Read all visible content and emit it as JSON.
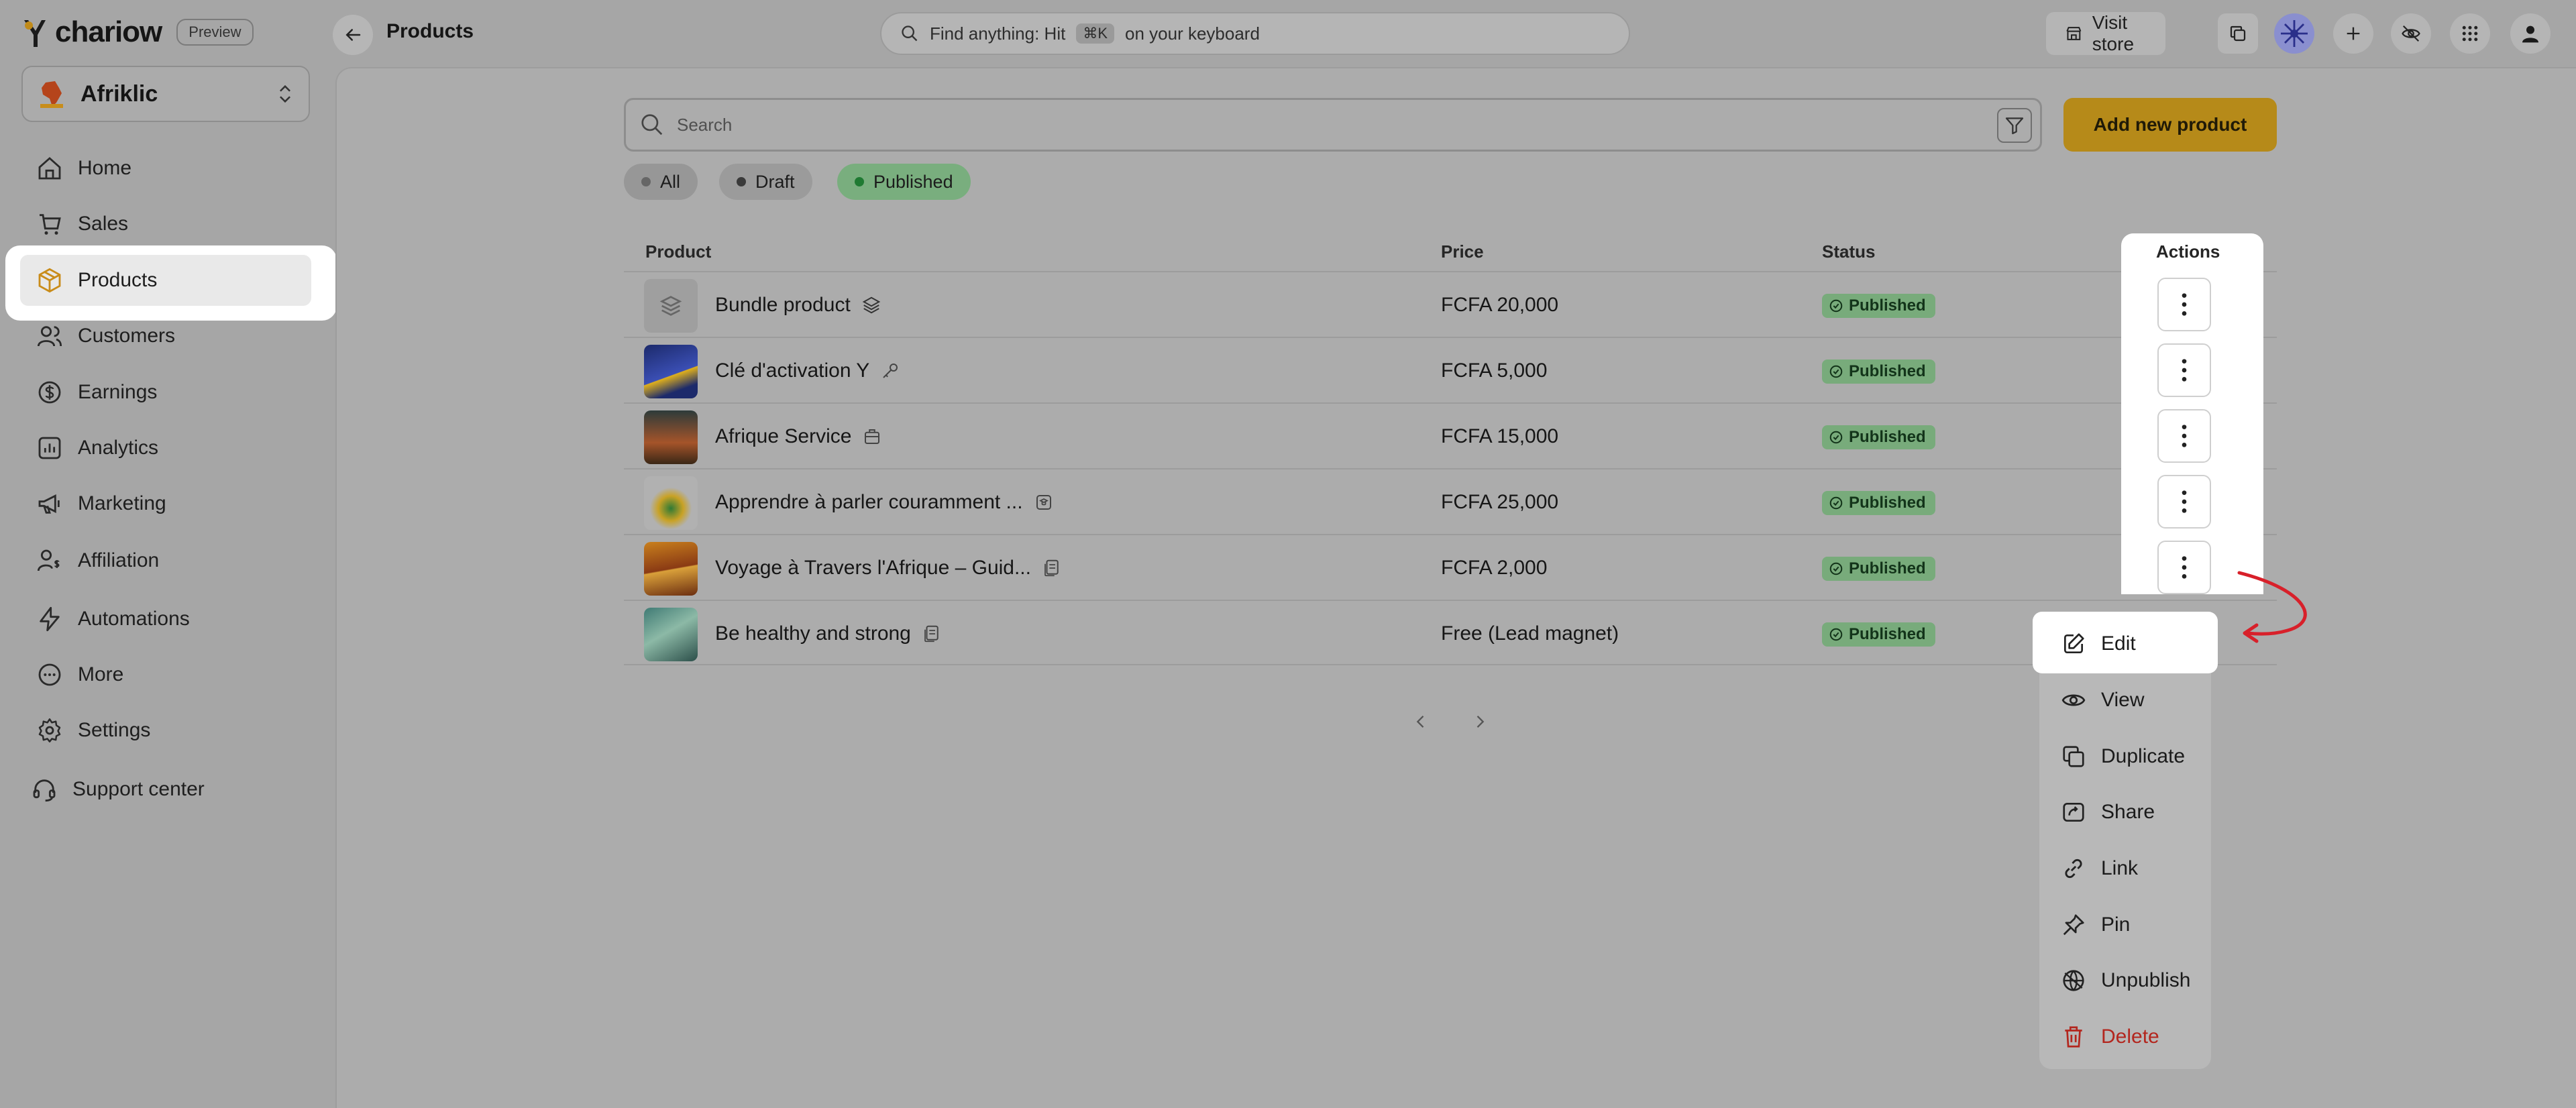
{
  "app": {
    "brand": "chariow",
    "preview_badge": "Preview",
    "page_title": "Products",
    "global_search_prefix": "Find anything: Hit",
    "global_search_kbd": "⌘K",
    "global_search_suffix": "on your keyboard",
    "visit_store": "Visit store"
  },
  "store": {
    "name": "Afriklic"
  },
  "sidebar": {
    "items": [
      {
        "label": "Home",
        "icon": "home-icon"
      },
      {
        "label": "Sales",
        "icon": "cart-icon"
      },
      {
        "label": "Products",
        "icon": "box-icon",
        "active": true
      },
      {
        "label": "Customers",
        "icon": "users-icon"
      },
      {
        "label": "Earnings",
        "icon": "earnings-icon"
      },
      {
        "label": "Analytics",
        "icon": "chart-icon"
      },
      {
        "label": "Marketing",
        "icon": "megaphone-icon"
      },
      {
        "label": "Affiliation",
        "icon": "affiliate-icon"
      },
      {
        "label": "Automations",
        "icon": "bolt-icon"
      },
      {
        "label": "More",
        "icon": "more-icon"
      },
      {
        "label": "Settings",
        "icon": "gear-icon"
      },
      {
        "label": "Support center",
        "icon": "headset-icon"
      }
    ]
  },
  "toolbar": {
    "search_placeholder": "Search",
    "add_button": "Add new product"
  },
  "filters": {
    "all": "All",
    "draft": "Draft",
    "published": "Published"
  },
  "table": {
    "headers": {
      "product": "Product",
      "price": "Price",
      "status": "Status",
      "actions": "Actions"
    },
    "rows": [
      {
        "name": "Bundle product",
        "price": "FCFA 20,000",
        "status": "Published",
        "type_icon": "layers-icon"
      },
      {
        "name": "Clé d'activation Y",
        "price": "FCFA 5,000",
        "status": "Published",
        "type_icon": "key-icon"
      },
      {
        "name": "Afrique Service",
        "price": "FCFA 15,000",
        "status": "Published",
        "type_icon": "service-icon"
      },
      {
        "name": "Apprendre à parler couramment ...",
        "price": "FCFA 25,000",
        "status": "Published",
        "type_icon": "course-icon"
      },
      {
        "name": "Voyage à Travers l'Afrique – Guid...",
        "price": "FCFA 2,000",
        "status": "Published",
        "type_icon": "file-icon"
      },
      {
        "name": "Be healthy and strong",
        "price": "Free (Lead magnet)",
        "status": "Published",
        "type_icon": "file-icon"
      }
    ]
  },
  "menu": {
    "items": [
      {
        "label": "Edit",
        "icon": "edit-icon"
      },
      {
        "label": "View",
        "icon": "eye-icon"
      },
      {
        "label": "Duplicate",
        "icon": "copy-icon"
      },
      {
        "label": "Share",
        "icon": "share-icon"
      },
      {
        "label": "Link",
        "icon": "link-icon"
      },
      {
        "label": "Pin",
        "icon": "pin-icon"
      },
      {
        "label": "Unpublish",
        "icon": "globe-off-icon"
      },
      {
        "label": "Delete",
        "icon": "trash-icon"
      }
    ]
  },
  "colors": {
    "accent": "#b68a19",
    "published_green": "#78ab7b",
    "delete_red": "#b3261e",
    "annotation_arrow": "#d8202a"
  }
}
